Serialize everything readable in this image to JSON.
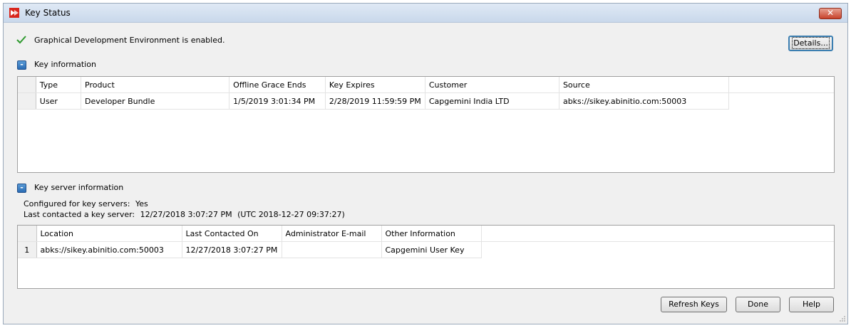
{
  "window": {
    "title": "Key Status",
    "close_label": "✕"
  },
  "status": {
    "message": "Graphical Development Environment is enabled.",
    "icon": "check-icon"
  },
  "buttons": {
    "details": "Details...",
    "refresh": "Refresh Keys",
    "done": "Done",
    "help": "Help"
  },
  "key_info": {
    "toggle": "-",
    "label": "Key information",
    "columns": [
      "Type",
      "Product",
      "Offline Grace Ends",
      "Key Expires",
      "Customer",
      "Source"
    ],
    "rows": [
      {
        "row_header": "",
        "cells": [
          "User",
          "Developer Bundle",
          "1/5/2019 3:01:34 PM",
          "2/28/2019 11:59:59 PM",
          "Capgemini India LTD",
          "abks://sikey.abinitio.com:50003"
        ]
      }
    ]
  },
  "key_server": {
    "toggle": "-",
    "label": "Key server information",
    "configured_label": "Configured for key servers:",
    "configured_value": "Yes",
    "last_contacted_label": "Last contacted a key server:",
    "last_contacted_value": "12/27/2018 3:07:27 PM",
    "last_contacted_utc": "(UTC 2018-12-27 09:37:27)",
    "columns": [
      "Location",
      "Last Contacted On",
      "Administrator E-mail",
      "Other Information"
    ],
    "rows": [
      {
        "row_header": "1",
        "cells": [
          "abks://sikey.abinitio.com:50003",
          "12/27/2018 3:07:27 PM",
          "",
          "Capgemini User Key"
        ]
      }
    ]
  }
}
